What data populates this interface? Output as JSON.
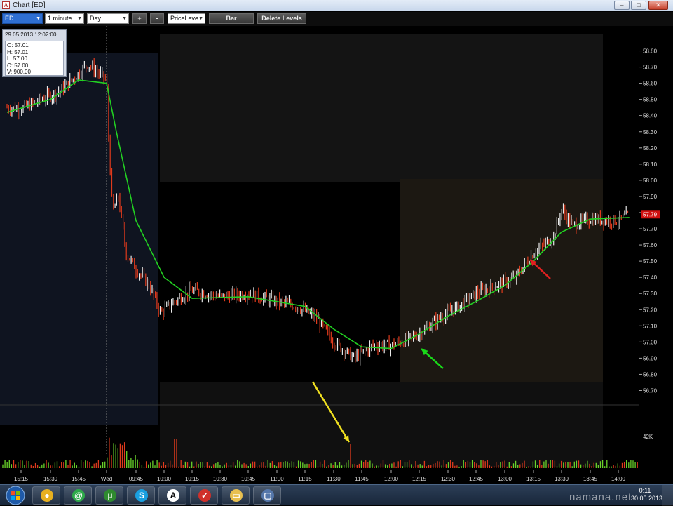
{
  "window": {
    "title": "Chart [ED]",
    "app_icon": "A",
    "minimize": "–",
    "maximize": "□",
    "close": "✕"
  },
  "toolbar": {
    "symbol": "ED",
    "interval": "1 minute",
    "range": "Day",
    "plus_label": "+",
    "minus_label": "-",
    "indicator": "PriceLeve",
    "style_label": "Bar",
    "delete_levels_label": "Delete Levels"
  },
  "info_box": {
    "date": "29.05.2013 12:02:00",
    "open": "O: 57.01",
    "high": "H: 57.01",
    "low": "L: 57.00",
    "close": "C: 57.00",
    "volume": "V: 900.00"
  },
  "chart_data": {
    "type": "bar",
    "symbol": "ED",
    "price_axis": {
      "ticks": [
        "58.80",
        "58.70",
        "58.60",
        "58.50",
        "58.40",
        "58.30",
        "58.20",
        "58.10",
        "58.00",
        "57.90",
        "57.80",
        "57.70",
        "57.60",
        "57.50",
        "57.40",
        "57.30",
        "57.20",
        "57.10",
        "57.00",
        "56.90",
        "56.80",
        "56.70"
      ],
      "ylim": [
        56.65,
        58.85
      ]
    },
    "last_price": "57.79",
    "volume_axis_label": "42K",
    "time_ticks": [
      "15:15",
      "15:30",
      "15:45",
      "Wed",
      "09:45",
      "10:00",
      "10:15",
      "10:30",
      "10:45",
      "11:00",
      "11:15",
      "11:30",
      "11:45",
      "12:00",
      "12:15",
      "12:30",
      "12:45",
      "13:00",
      "13:15",
      "13:30",
      "13:45",
      "14:00"
    ],
    "price_path": [
      [
        "15:10",
        58.45
      ],
      [
        "15:15",
        58.44
      ],
      [
        "15:25",
        58.5
      ],
      [
        "15:35",
        58.55
      ],
      [
        "15:45",
        58.66
      ],
      [
        "15:50",
        58.72
      ],
      [
        "Wed",
        58.62
      ],
      [
        "09:31",
        58.28
      ],
      [
        "09:33",
        57.8
      ],
      [
        "09:36",
        57.9
      ],
      [
        "09:40",
        57.55
      ],
      [
        "09:45",
        57.45
      ],
      [
        "09:52",
        57.35
      ],
      [
        "09:58",
        57.18
      ],
      [
        "10:05",
        57.25
      ],
      [
        "10:15",
        57.32
      ],
      [
        "10:30",
        57.28
      ],
      [
        "10:45",
        57.3
      ],
      [
        "11:00",
        57.25
      ],
      [
        "11:10",
        57.22
      ],
      [
        "11:20",
        57.15
      ],
      [
        "11:30",
        57.0
      ],
      [
        "11:40",
        56.9
      ],
      [
        "11:50",
        56.98
      ],
      [
        "12:00",
        56.98
      ],
      [
        "12:05",
        57.0
      ],
      [
        "12:15",
        57.05
      ],
      [
        "12:25",
        57.15
      ],
      [
        "12:35",
        57.22
      ],
      [
        "12:45",
        57.3
      ],
      [
        "12:55",
        57.35
      ],
      [
        "13:05",
        57.4
      ],
      [
        "13:15",
        57.55
      ],
      [
        "13:25",
        57.65
      ],
      [
        "13:30",
        57.82
      ],
      [
        "13:35",
        57.72
      ],
      [
        "13:45",
        57.76
      ],
      [
        "14:00",
        57.75
      ],
      [
        "14:05",
        57.79
      ]
    ],
    "moving_average": [
      [
        "15:10",
        58.42
      ],
      [
        "15:30",
        58.5
      ],
      [
        "15:45",
        58.62
      ],
      [
        "Wed",
        58.6
      ],
      [
        "09:35",
        58.3
      ],
      [
        "09:45",
        57.75
      ],
      [
        "10:00",
        57.4
      ],
      [
        "10:15",
        57.27
      ],
      [
        "10:45",
        57.28
      ],
      [
        "11:15",
        57.22
      ],
      [
        "11:30",
        57.08
      ],
      [
        "11:45",
        56.97
      ],
      [
        "12:00",
        56.96
      ],
      [
        "12:15",
        57.05
      ],
      [
        "12:30",
        57.16
      ],
      [
        "12:45",
        57.25
      ],
      [
        "13:00",
        57.35
      ],
      [
        "13:15",
        57.5
      ],
      [
        "13:30",
        57.68
      ],
      [
        "13:45",
        57.76
      ],
      [
        "14:05",
        57.77
      ]
    ],
    "grid": false
  },
  "annotations": {
    "arrows": [
      {
        "color": "#19d919",
        "points_to": "12:15 low"
      },
      {
        "color": "#e02020",
        "points_to": "13:15 bar"
      },
      {
        "color": "#f0e020",
        "points_to": "11:30 volume spike"
      }
    ]
  },
  "taskbar": {
    "clock_time": "0:11",
    "clock_date": "30.05.2013",
    "apps": [
      "chrome-icon",
      "chat-icon",
      "utorrent-icon",
      "skype-icon",
      "font-app-icon",
      "chart-app-icon",
      "folder-icon",
      "window-icon"
    ]
  },
  "watermark": "namana.net"
}
